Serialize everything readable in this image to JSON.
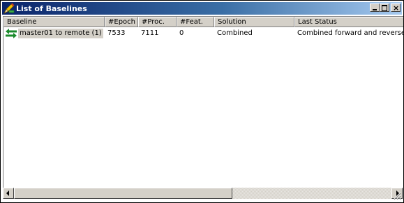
{
  "window": {
    "title": "List of Baselines",
    "title_icon": "pencil-ruler-icon",
    "buttons": {
      "minimize_icon": "minimize-icon",
      "maximize_icon": "maximize-icon",
      "close_label": "×"
    }
  },
  "table": {
    "columns": [
      "Baseline",
      "#Epoch",
      "#Proc.",
      "#Feat.",
      "Solution",
      "Last Status"
    ],
    "rows": [
      {
        "icon": "two-way-arrows-icon",
        "baseline": "master01 to remote (1)",
        "epoch": "7533",
        "proc": "7111",
        "feat": "0",
        "solution": "Combined",
        "last_status": "Combined forward and reverse"
      }
    ]
  },
  "scrollbar": {
    "left_icon": "scroll-left-arrow-icon",
    "right_icon": "scroll-right-arrow-icon"
  },
  "colors": {
    "titlebar_start": "#0a246a",
    "titlebar_end": "#a6caf0",
    "face": "#d4d0c8",
    "selection": "#d4d0c8"
  }
}
